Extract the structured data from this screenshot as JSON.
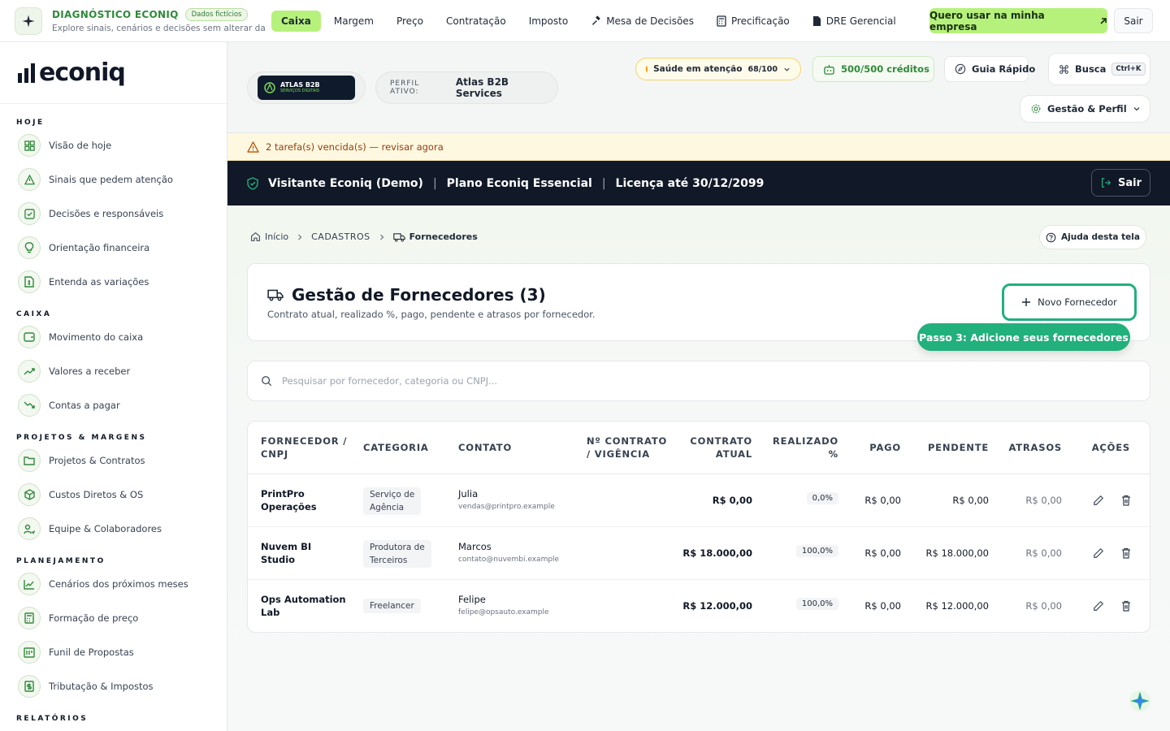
{
  "topbar": {
    "diag_title": "DIAGNÓSTICO ECONIQ",
    "diag_badge": "Dados fictícios",
    "diag_sub": "Explore sinais, cenários e decisões sem alterar da...",
    "tabs": [
      {
        "label": "Caixa",
        "active": true,
        "icon": ""
      },
      {
        "label": "Margem",
        "active": false,
        "icon": ""
      },
      {
        "label": "Preço",
        "active": false,
        "icon": ""
      },
      {
        "label": "Contratação",
        "active": false,
        "icon": ""
      },
      {
        "label": "Imposto",
        "active": false,
        "icon": ""
      },
      {
        "label": "Mesa de Decisões",
        "active": false,
        "icon": "gavel-icon"
      },
      {
        "label": "Precificação",
        "active": false,
        "icon": "calculator-icon"
      },
      {
        "label": "DRE Gerencial",
        "active": false,
        "icon": "document-icon"
      }
    ],
    "cta": "Quero usar na minha empresa",
    "sair": "Sair"
  },
  "sidebar": {
    "brand": "econiq",
    "sections": [
      {
        "title": "HOJE",
        "items": [
          "Visão de hoje",
          "Sinais que pedem atenção",
          "Decisões e responsáveis",
          "Orientação financeira",
          "Entenda as variações"
        ]
      },
      {
        "title": "CAIXA",
        "items": [
          "Movimento do caixa",
          "Valores a receber",
          "Contas a pagar"
        ]
      },
      {
        "title": "PROJETOS & MARGENS",
        "items": [
          "Projetos & Contratos",
          "Custos Diretos & OS",
          "Equipe & Colaboradores"
        ]
      },
      {
        "title": "PLANEJAMENTO",
        "items": [
          "Cenários dos próximos meses",
          "Formação de preço",
          "Funil de Propostas",
          "Tributação & Impostos"
        ]
      },
      {
        "title": "RELATÓRIOS",
        "items": []
      }
    ]
  },
  "header": {
    "atlas_logo_line1": "ATLAS B2B",
    "atlas_logo_line2": "SERVIÇOS DIGITAIS",
    "perfil_label": "PERFIL ATIVO:",
    "perfil_value": "Atlas B2B Services",
    "health_label": "Saúde em atenção",
    "health_score": "68/100",
    "credits": "500/500 créditos",
    "guia": "Guia Rápido",
    "busca": "Busca",
    "busca_kbd": "Ctrl+K",
    "gestao": "Gestão & Perfil"
  },
  "alert": "2 tarefa(s) vencida(s) — revisar agora",
  "license": {
    "user": "Visitante Econiq (Demo)",
    "plan": "Plano Econiq Essencial",
    "valid": "Licença até 30/12/2099",
    "sair": "Sair"
  },
  "breadcrumb": {
    "home": "Início",
    "section": "CADASTROS",
    "current": "Fornecedores"
  },
  "help": "Ajuda desta tela",
  "page": {
    "title": "Gestão de Fornecedores (3)",
    "subtitle": "Contrato atual, realizado %, pago, pendente e atrasos por fornecedor.",
    "new_button": "Novo Fornecedor",
    "tour_tip": "Passo 3: Adicione seus fornecedores"
  },
  "search": {
    "placeholder": "Pesquisar por fornecedor, categoria ou CNPJ..."
  },
  "table": {
    "headers": {
      "fornecedor": [
        "FORNECEDOR /",
        "CNPJ"
      ],
      "categoria": "CATEGORIA",
      "contato": "CONTATO",
      "contrato": [
        "Nº CONTRATO",
        "/ VIGÊNCIA"
      ],
      "contrato_atual": [
        "CONTRATO",
        "ATUAL"
      ],
      "realizado": [
        "REALIZADO",
        "%"
      ],
      "pago": "PAGO",
      "pendente": "PENDENTE",
      "atrasos": "ATRASOS",
      "acoes": "AÇÕES"
    },
    "rows": [
      {
        "name": [
          "PrintPro",
          "Operações"
        ],
        "category": [
          "Serviço de",
          "Agência"
        ],
        "contact": "Julia",
        "email": "vendas@printpro.example",
        "contract_current": "R$ 0,00",
        "realized": "0,0%",
        "paid": "R$ 0,00",
        "pending": "R$ 0,00",
        "overdue": "R$ 0,00"
      },
      {
        "name": [
          "Nuvem BI",
          "Studio"
        ],
        "category": [
          "Produtora de",
          "Terceiros"
        ],
        "contact": "Marcos",
        "email": "contato@nuvembi.example",
        "contract_current": "R$ 18.000,00",
        "realized": "100,0%",
        "paid": "R$ 0,00",
        "pending": "R$ 18.000,00",
        "overdue": "R$ 0,00"
      },
      {
        "name": [
          "Ops Automation",
          "Lab"
        ],
        "category": [
          "Freelancer"
        ],
        "contact": "Felipe",
        "email": "felipe@opsauto.example",
        "contract_current": "R$ 12.000,00",
        "realized": "100,0%",
        "paid": "R$ 0,00",
        "pending": "R$ 12.000,00",
        "overdue": "R$ 0,00"
      }
    ]
  }
}
